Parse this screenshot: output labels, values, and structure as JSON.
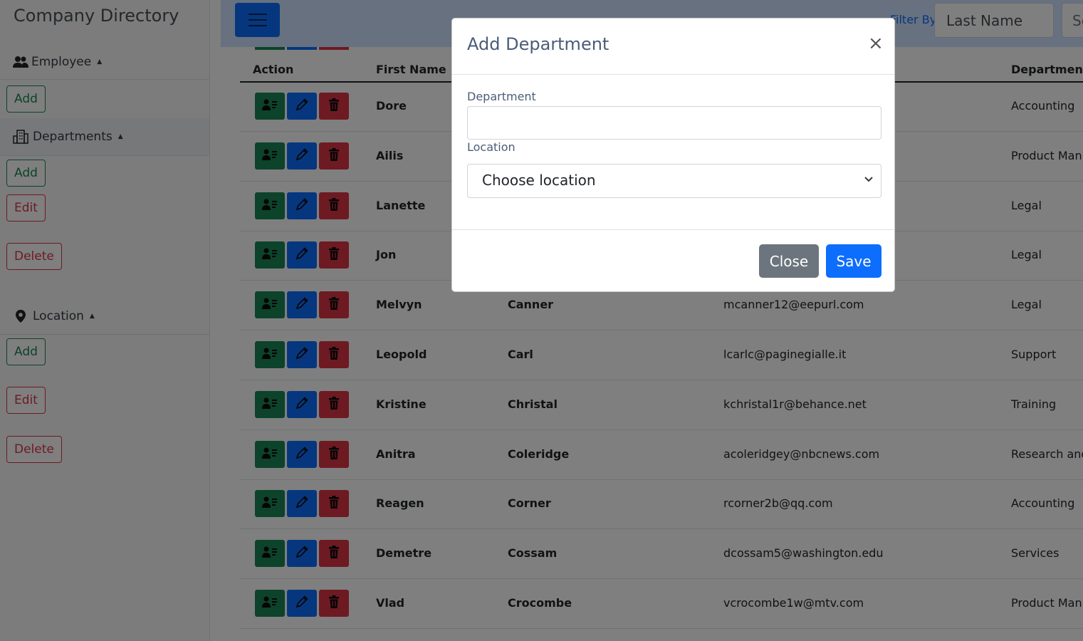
{
  "sidebar": {
    "brand": "Company Directory",
    "employee": {
      "label": "Employee",
      "caret": "▲",
      "add": "Add"
    },
    "departments": {
      "label": "Departments",
      "caret": "▲",
      "add": "Add",
      "edit": "Edit",
      "delete": "Delete"
    },
    "location": {
      "label": "Location",
      "caret": "▲",
      "add": "Add",
      "edit": "Edit",
      "delete": "Delete"
    }
  },
  "topbar": {
    "filter_label": "Filter By",
    "filter_value": "Last Name",
    "search_placeholder": "Se"
  },
  "table": {
    "headers": {
      "action": "Action",
      "first": "First Name",
      "dept": "Department"
    },
    "rows": [
      {
        "first": "Dore",
        "last": "",
        "email": "",
        "dept": "Accounting"
      },
      {
        "first": "Ailis",
        "last": "",
        "email": "",
        "dept": "Product Man"
      },
      {
        "first": "Lanette",
        "last": "",
        "email": "",
        "dept": "Legal"
      },
      {
        "first": "Jon",
        "last": "",
        "email": "",
        "dept": "Legal"
      },
      {
        "first": "Melvyn",
        "last": "Canner",
        "email": "mcanner12@eepurl.com",
        "dept": "Legal"
      },
      {
        "first": "Leopold",
        "last": "Carl",
        "email": "lcarlc@paginegialle.it",
        "dept": "Support"
      },
      {
        "first": "Kristine",
        "last": "Christal",
        "email": "kchristal1r@behance.net",
        "dept": "Training"
      },
      {
        "first": "Anitra",
        "last": "Coleridge",
        "email": "acoleridgey@nbcnews.com",
        "dept": "Research and"
      },
      {
        "first": "Reagen",
        "last": "Corner",
        "email": "rcorner2b@qq.com",
        "dept": "Accounting"
      },
      {
        "first": "Demetre",
        "last": "Cossam",
        "email": "dcossam5@washington.edu",
        "dept": "Services"
      },
      {
        "first": "Vlad",
        "last": "Crocombe",
        "email": "vcrocombe1w@mtv.com",
        "dept": "Product Man"
      }
    ]
  },
  "modal": {
    "title": "Add Department",
    "close_x": "×",
    "department_label": "Department",
    "department_value": "",
    "location_label": "Location",
    "location_selected": "Choose location",
    "close_button": "Close",
    "save_button": "Save"
  },
  "colors": {
    "primary": "#0d6efd",
    "success": "#198754",
    "danger": "#dc3545",
    "secondary": "#6c757d"
  }
}
